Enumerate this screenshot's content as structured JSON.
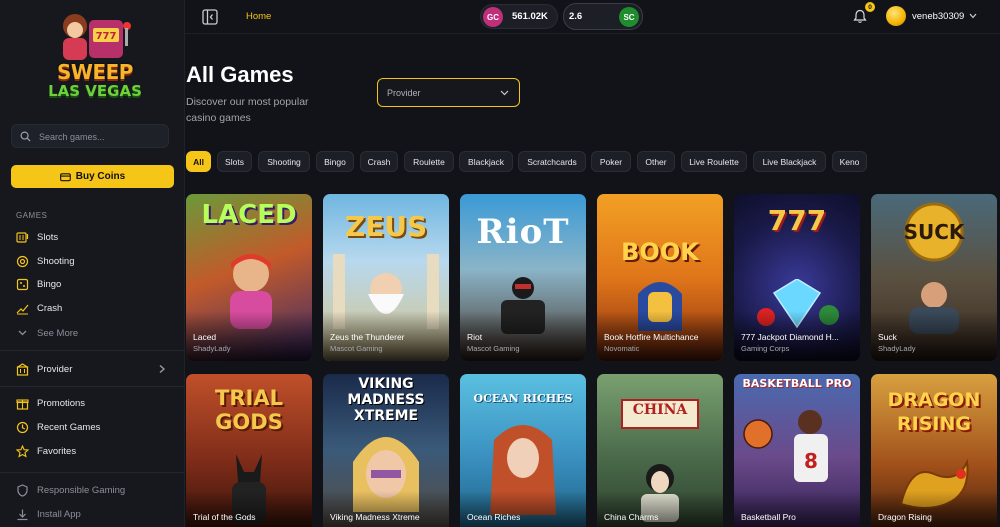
{
  "brand": {
    "line1": "SWEEP",
    "line2": "LAS VEGAS"
  },
  "search": {
    "placeholder": "Search games..."
  },
  "buy_button": {
    "label": "Buy Coins"
  },
  "sidebar": {
    "games_heading": "GAMES",
    "games": [
      {
        "label": "Slots",
        "icon": "slot-machine-icon"
      },
      {
        "label": "Shooting",
        "icon": "crosshair-icon"
      },
      {
        "label": "Bingo",
        "icon": "bingo-card-icon"
      },
      {
        "label": "Crash",
        "icon": "chart-line-icon"
      }
    ],
    "see_more": "See More",
    "provider": "Provider",
    "links": [
      {
        "label": "Promotions",
        "icon": "gift-icon"
      },
      {
        "label": "Recent Games",
        "icon": "clock-icon"
      },
      {
        "label": "Favorites",
        "icon": "star-icon"
      }
    ],
    "footer": [
      {
        "label": "Responsible Gaming",
        "icon": "shield-icon"
      },
      {
        "label": "Install App",
        "icon": "download-icon"
      }
    ]
  },
  "topbar": {
    "home": "Home",
    "gc": {
      "badge": "GC",
      "value": "561.02K"
    },
    "sc": {
      "badge": "SC",
      "value": "2.6"
    },
    "notifications": "0",
    "username": "veneb30309"
  },
  "main": {
    "title": "All Games",
    "subtitle": "Discover our most popular casino games",
    "provider_select": "Provider",
    "filters": [
      "All",
      "Slots",
      "Shooting",
      "Bingo",
      "Crash",
      "Roulette",
      "Blackjack",
      "Scratchcards",
      "Poker",
      "Other",
      "Live Roulette",
      "Live Blackjack",
      "Keno"
    ],
    "active_filter": "All",
    "games": [
      {
        "title": "Laced",
        "provider": "ShadyLady",
        "art": "LACED"
      },
      {
        "title": "Zeus the Thunderer",
        "provider": "Mascot Gaming",
        "art": "ZEUS"
      },
      {
        "title": "Riot",
        "provider": "Mascot Gaming",
        "art": "RioT"
      },
      {
        "title": "Book Hotfire Multichance",
        "provider": "Novomatic",
        "art": "BOOK"
      },
      {
        "title": "777 Jackpot Diamond H...",
        "provider": "Gaming Corps",
        "art": "777"
      },
      {
        "title": "Suck",
        "provider": "ShadyLady",
        "art": "SUCK"
      },
      {
        "title": "Trial of the Gods",
        "provider": "",
        "art": "TRIAL GODS"
      },
      {
        "title": "Viking Madness Xtreme",
        "provider": "",
        "art": "VIKING MADNESS XTREME"
      },
      {
        "title": "Ocean Riches",
        "provider": "",
        "art": "OCEAN RICHES"
      },
      {
        "title": "China Charms",
        "provider": "",
        "art": "CHINA"
      },
      {
        "title": "Basketball Pro",
        "provider": "",
        "art": "BASKETBALL PRO"
      },
      {
        "title": "Dragon Rising",
        "provider": "",
        "art": "DRAGON RISING"
      }
    ]
  },
  "colors": {
    "accent": "#f5c518",
    "background": "#111318",
    "gc": "#c0307a",
    "sc": "#1f8d2e"
  }
}
